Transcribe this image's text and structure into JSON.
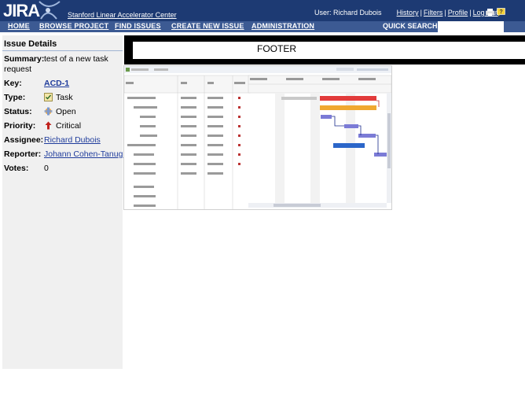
{
  "header": {
    "logo_text": "JIRA",
    "site_name": "Stanford Linear Accelerator Center",
    "user_label": "User: Richard Dubois",
    "links": [
      "History",
      "Filters",
      "Profile",
      "Log Out"
    ]
  },
  "nav": {
    "items": [
      "HOME",
      "BROWSE PROJECT",
      "FIND ISSUES",
      "CREATE NEW ISSUE",
      "ADMINISTRATION"
    ],
    "quick_search_label": "QUICK SEARCH:",
    "quick_search_value": ""
  },
  "issue": {
    "panel_title": "Issue Details",
    "summary_label": "Summary:",
    "summary_value_line1": "test of a new task",
    "summary_value_line2": "request",
    "key_label": "Key:",
    "key_value": "ACD-1",
    "type_label": "Type:",
    "type_value": "Task",
    "status_label": "Status:",
    "status_value": "Open",
    "priority_label": "Priority:",
    "priority_value": "Critical",
    "assignee_label": "Assignee:",
    "assignee_value": "Richard Dubois",
    "reporter_label": "Reporter:",
    "reporter_value": "Johann Cohen-Tanugi",
    "votes_label": "Votes:",
    "votes_value": "0"
  },
  "footer": {
    "text": "FOOTER"
  },
  "colors": {
    "header_bg": "#1d3a73",
    "nav_bg": "#3c5a93",
    "panel_bg": "#f0f0f0",
    "link": "#1f3c9c"
  },
  "icons": {
    "type": "task-icon",
    "status": "open-status-icon",
    "priority": "critical-priority-icon"
  }
}
